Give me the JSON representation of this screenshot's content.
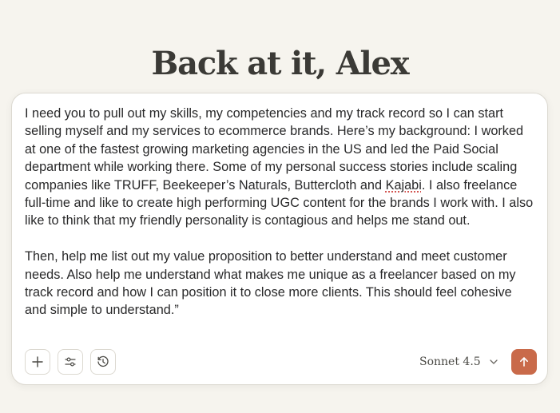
{
  "greeting": "Back at it, Alex",
  "composer": {
    "paragraphs": [
      {
        "before": "I need you to pull out my skills, my competencies and my track record so I can start selling myself and my services to ecommerce brands. Here’s my background: I worked at one of the fastest growing marketing agencies in the US and led the Paid Social department while working there. Some of my personal success stories include scaling companies like TRUFF, Beekeeper’s Naturals, Buttercloth and ",
        "flagged_word": "Kajabi",
        "after": ". I also freelance full-time and like to create high performing UGC content for the brands I work with. I also like to think that my friendly personality is contagious and helps me stand out."
      },
      {
        "text": "Then, help me list out my value proposition to better understand and meet customer needs. Also help me understand what makes me unique as a freelancer based on my track record and how I can position it to close more clients. This should feel cohesive and simple to understand.”"
      }
    ],
    "toolbar": {
      "add_icon": "plus-icon",
      "tools_icon": "sliders-icon",
      "history_icon": "clock-history-icon"
    },
    "model": {
      "selected": "Sonnet 4.5",
      "icon": "chevron-down-icon"
    },
    "send": {
      "icon": "arrow-up-icon",
      "color": "#c96a4a"
    }
  },
  "colors": {
    "background": "#f6f4ee",
    "text": "#29292a",
    "accent": "#c96a4a"
  }
}
